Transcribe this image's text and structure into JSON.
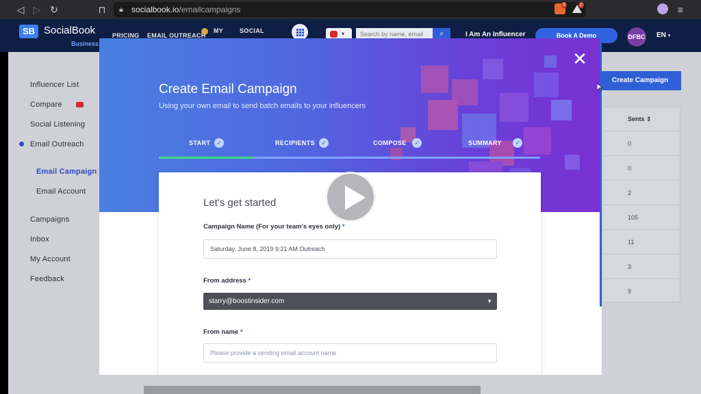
{
  "browser": {
    "url_host": "socialbook.io",
    "url_path": "/emailcampaigns",
    "ext_badges": [
      "5",
      "2"
    ]
  },
  "header": {
    "logo_mark": "SB",
    "logo_text": "SocialBook",
    "logo_sub": "Business",
    "nav": [
      "PRICING",
      "EMAIL OUTREACH",
      "MY",
      "SOCIAL"
    ],
    "search_placeholder": "Search by name, email",
    "influencer_link": "I Am An Influencer",
    "demo_button": "Book A Demo",
    "avatar": "DFBC",
    "language": "EN"
  },
  "sidebar": {
    "items": [
      {
        "label": "Influencer List"
      },
      {
        "label": "Compare"
      },
      {
        "label": "Social Listening"
      },
      {
        "label": "Email Outreach"
      },
      {
        "label": "Email Campaign"
      },
      {
        "label": "Email Account"
      },
      {
        "label": "Campaigns"
      },
      {
        "label": "Inbox"
      },
      {
        "label": "My Account"
      },
      {
        "label": "Feedback"
      }
    ]
  },
  "main": {
    "create_button": "Create Campaign",
    "sents_header": "Sents ⇕",
    "sents": [
      "0",
      "0",
      "2",
      "105",
      "11",
      "3",
      "9"
    ]
  },
  "modal": {
    "title": "Create Email Campaign",
    "subtitle": "Using your own email to send batch emails to your influencers",
    "close": "✕",
    "steps": [
      {
        "label": "START",
        "check": "✓"
      },
      {
        "label": "RECIPIENTS",
        "check": "✓"
      },
      {
        "label": "COMPOSE",
        "check": "✓"
      },
      {
        "label": "SUMMARY",
        "check": "✓"
      }
    ],
    "step_progress": 0.25,
    "form": {
      "heading": "Let's get started",
      "campaign_name_label": "Campaign Name (For your team's eyes only)",
      "campaign_name_value": "Saturday, June 8, 2019 9:21 AM Outreach",
      "from_address_label": "From address",
      "from_address_value": "starry@boostinsider.com",
      "from_name_label": "From name",
      "from_name_placeholder": "Please provide a sending email account name",
      "required_mark": "*"
    }
  },
  "colors": {
    "header_bg": "#0f1e44",
    "accent": "#2f5fd6",
    "progress": "#3ddc84",
    "hero_start": "#4a7fe0",
    "hero_end": "#7a30d2"
  },
  "icons": [
    "back-icon",
    "forward-icon",
    "reload-icon",
    "bookmark-icon",
    "lock-icon",
    "brave-icon",
    "alert-icon",
    "profile-icon",
    "menu-icon",
    "apps-grid-icon",
    "youtube-icon",
    "search-icon",
    "close-icon",
    "check-icon",
    "play-icon",
    "sort-icon",
    "caret-down-icon"
  ]
}
